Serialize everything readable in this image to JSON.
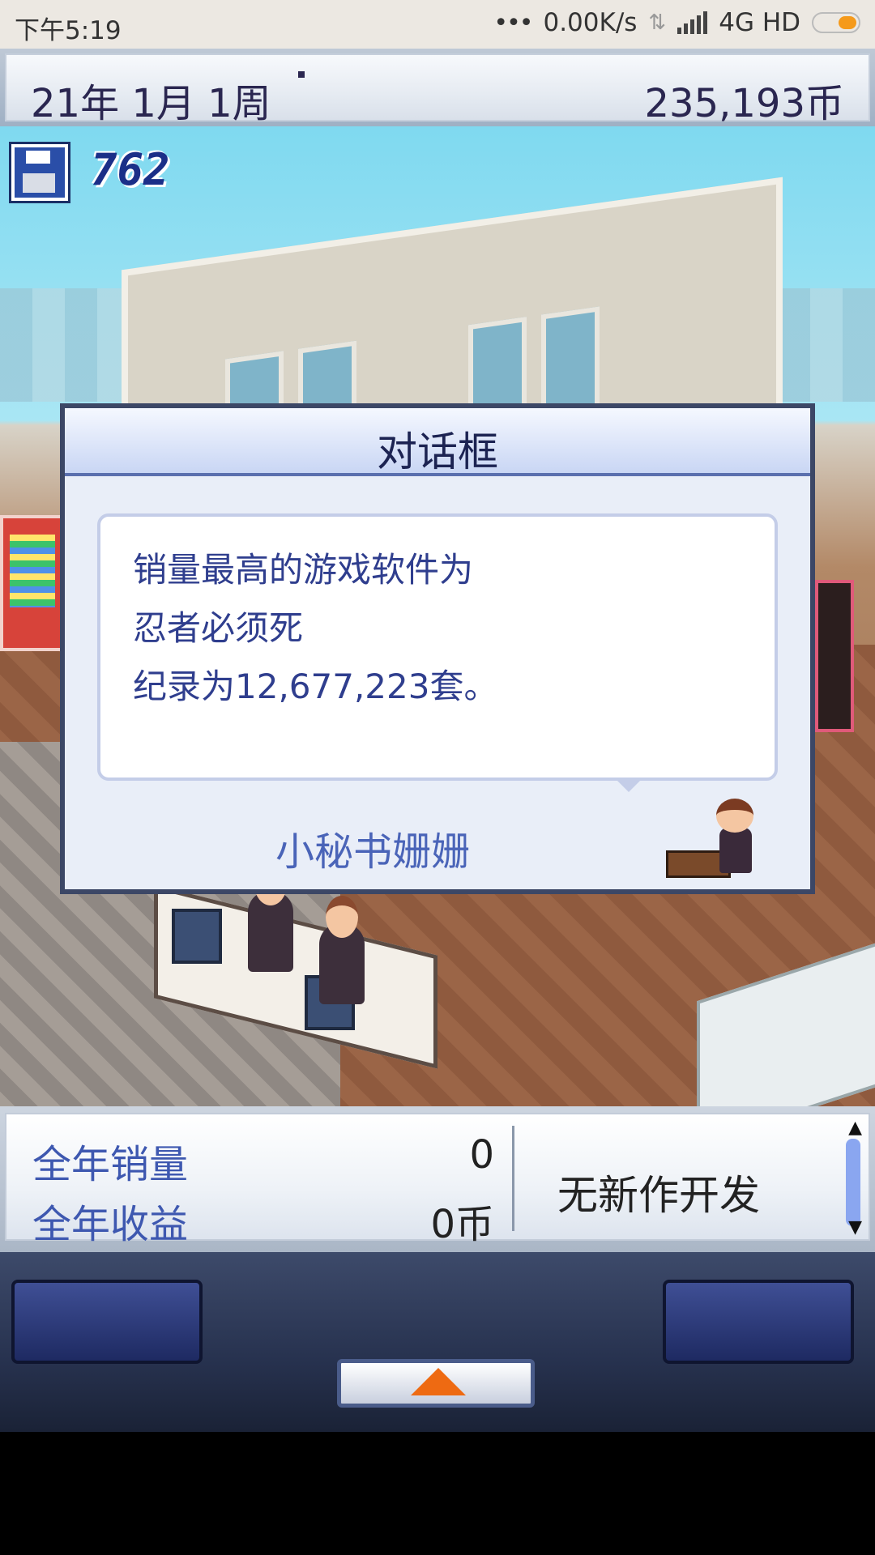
{
  "status_bar": {
    "time": "下午5:19",
    "dots": "•••",
    "speed": "0.00K/s",
    "network": "4G HD"
  },
  "header": {
    "date": "21年 1月 1周",
    "money": "235,193币"
  },
  "save": {
    "count": "762"
  },
  "dialog": {
    "title": "对话框",
    "lines": [
      "销量最高的游戏软件为",
      "忍者必须死",
      "纪录为12,677,223套。"
    ],
    "speaker": "小秘书姗姗"
  },
  "info_panel": {
    "sales_label": "全年销量",
    "sales_value": "0",
    "income_label": "全年收益",
    "income_value": "0币",
    "dev_status": "无新作开发"
  },
  "colors": {
    "accent_blue": "#3e58b0",
    "dialog_text": "#2f3e8e",
    "arrow_orange": "#ee6a12"
  },
  "icons": [
    "disk-icon",
    "signal-icon",
    "battery-icon",
    "arrow-up-icon",
    "scroll-up-icon",
    "scroll-down-icon"
  ]
}
